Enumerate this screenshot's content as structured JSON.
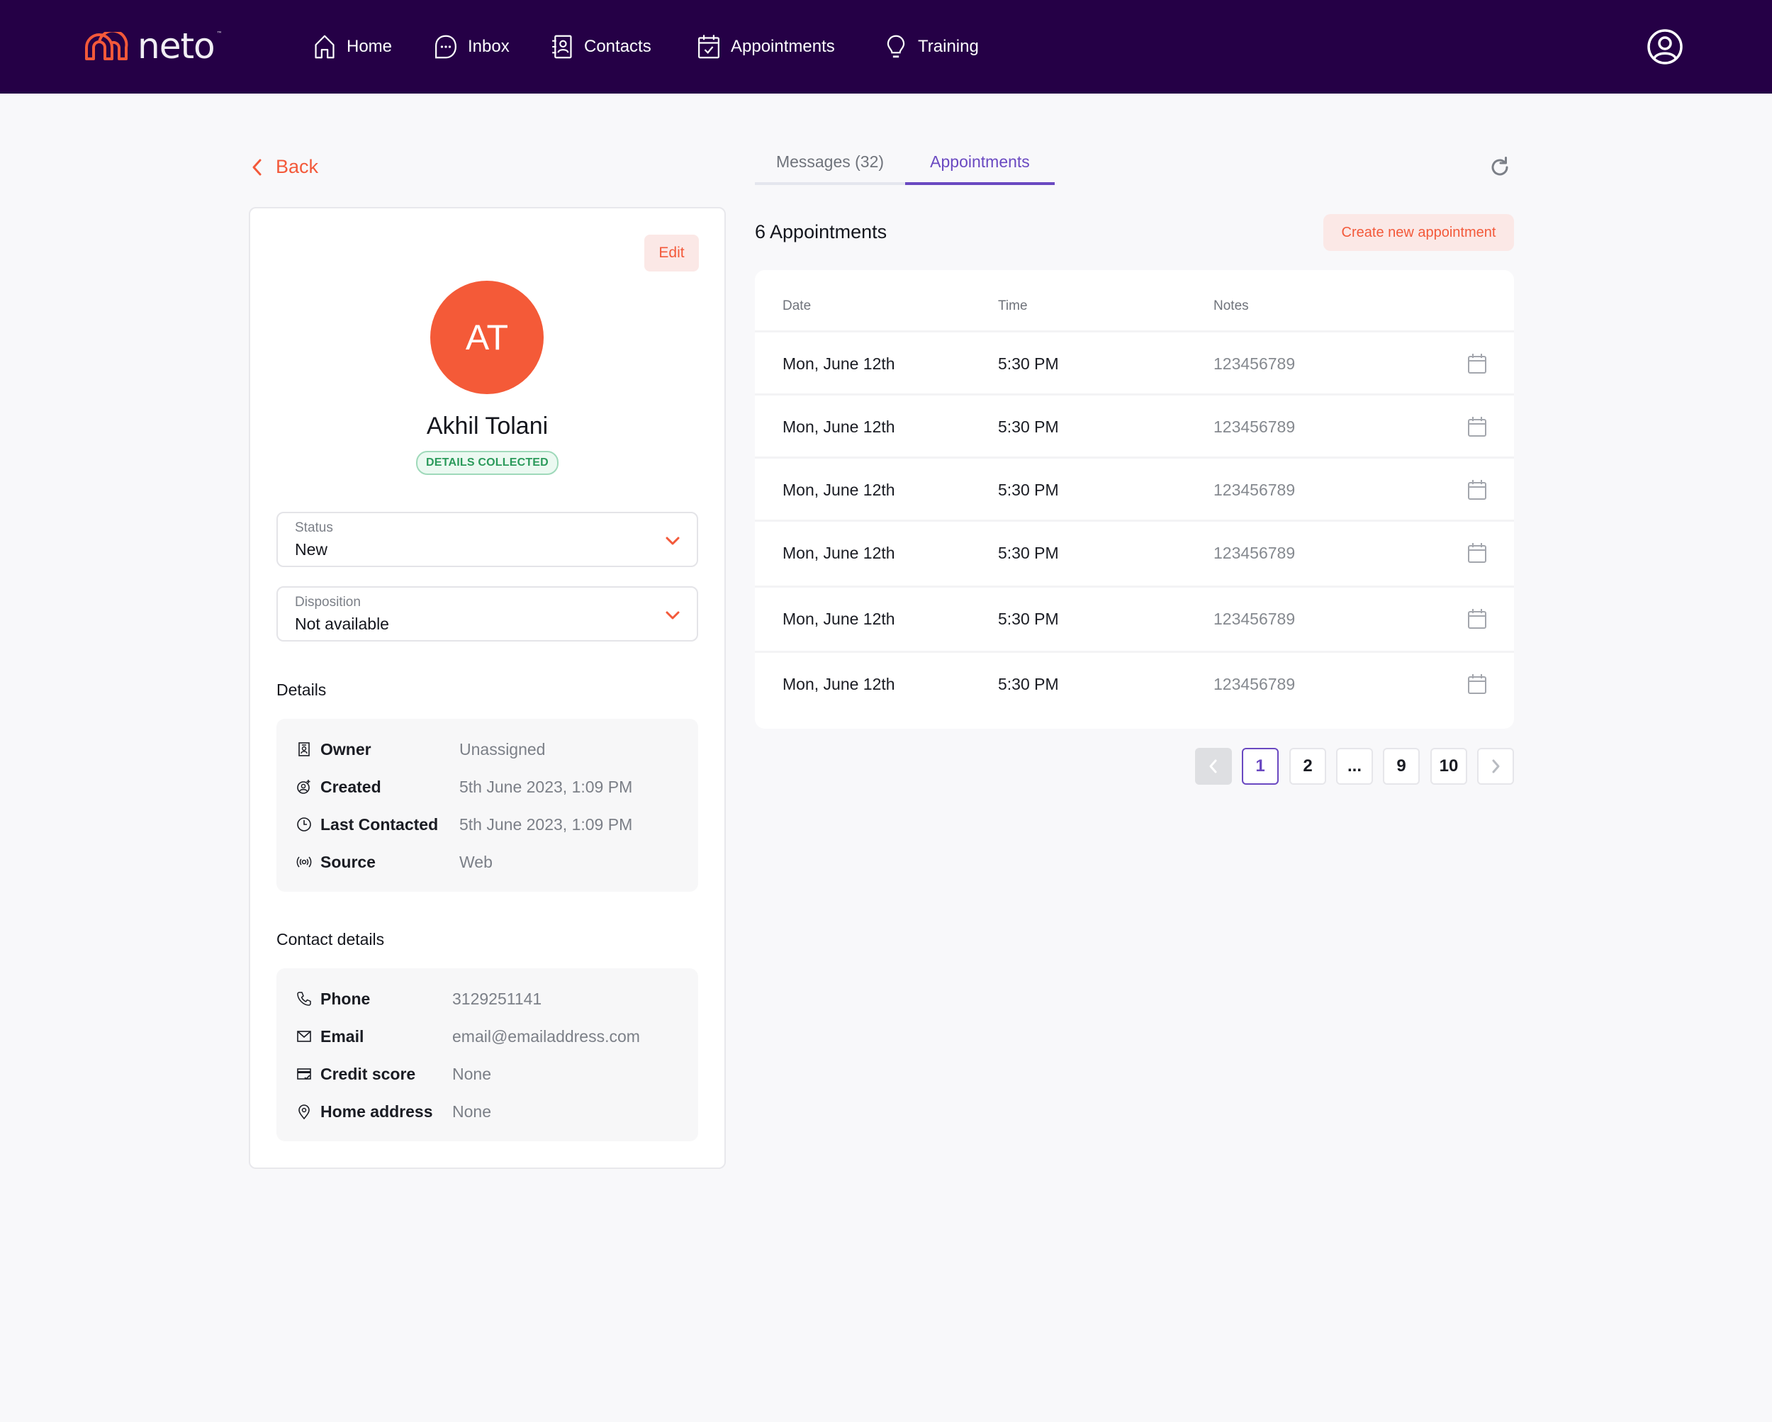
{
  "brand": {
    "name": "neto",
    "trademark": "™",
    "accent": "#f3593a",
    "nav_bg": "#250046",
    "tab_accent": "#6a49c1"
  },
  "nav": {
    "items": [
      {
        "label": "Home",
        "icon": "home-icon"
      },
      {
        "label": "Inbox",
        "icon": "chat-bubble-icon"
      },
      {
        "label": "Contacts",
        "icon": "contact-book-icon"
      },
      {
        "label": "Appointments",
        "icon": "calendar-check-icon"
      },
      {
        "label": "Training",
        "icon": "lightbulb-icon"
      }
    ],
    "profile_icon": "user-circle-icon"
  },
  "back": {
    "label": "Back"
  },
  "contact": {
    "edit_label": "Edit",
    "initials": "AT",
    "name": "Akhil Tolani",
    "badge": "DETAILS COLLECTED",
    "status": {
      "label": "Status",
      "value": "New"
    },
    "disposition": {
      "label": "Disposition",
      "value": "Not available"
    },
    "details_heading": "Details",
    "details": [
      {
        "key": "Owner",
        "value": "Unassigned",
        "icon": "id-badge-icon"
      },
      {
        "key": "Created",
        "value": "5th June 2023, 1:09 PM",
        "icon": "user-add-icon"
      },
      {
        "key": "Last Contacted",
        "value": "5th June 2023, 1:09 PM",
        "icon": "clock-icon"
      },
      {
        "key": "Source",
        "value": "Web",
        "icon": "broadcast-icon"
      }
    ],
    "contact_heading": "Contact details",
    "contact_details": [
      {
        "key": "Phone",
        "value": "3129251141",
        "icon": "phone-icon"
      },
      {
        "key": "Email",
        "value": "email@emailaddress.com",
        "icon": "mail-icon"
      },
      {
        "key": "Credit score",
        "value": "None",
        "icon": "credit-card-icon"
      },
      {
        "key": "Home address",
        "value": "None",
        "icon": "map-pin-icon"
      }
    ]
  },
  "tabs": [
    {
      "label": "Messages (32)",
      "active": false
    },
    {
      "label": "Appointments",
      "active": true
    }
  ],
  "appointments": {
    "count_label": "6 Appointments",
    "create_label": "Create new appointment",
    "columns": [
      "Date",
      "Time",
      "Notes"
    ],
    "rows": [
      {
        "date": "Mon, June 12th",
        "time": "5:30 PM",
        "notes": "123456789"
      },
      {
        "date": "Mon, June 12th",
        "time": "5:30 PM",
        "notes": "123456789"
      },
      {
        "date": "Mon, June 12th",
        "time": "5:30 PM",
        "notes": "123456789"
      },
      {
        "date": "Mon, June 12th",
        "time": "5:30 PM",
        "notes": "123456789"
      },
      {
        "date": "Mon, June 12th",
        "time": "5:30 PM",
        "notes": "123456789"
      },
      {
        "date": "Mon, June 12th",
        "time": "5:30 PM",
        "notes": "123456789"
      }
    ]
  },
  "pagination": {
    "pages": [
      "1",
      "2",
      "...",
      "9",
      "10"
    ],
    "current": "1",
    "prev_disabled": true
  }
}
